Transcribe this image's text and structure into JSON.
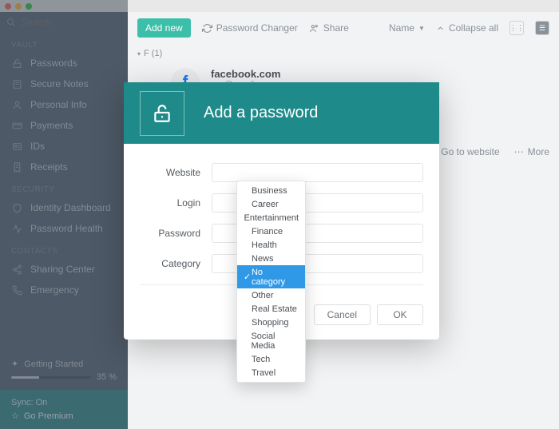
{
  "search": {
    "placeholder": "Search"
  },
  "sidebar": {
    "sections": {
      "vault": "Vault",
      "security": "Security",
      "contacts": "Contacts"
    },
    "items": [
      {
        "label": "Passwords",
        "icon": "lock-icon"
      },
      {
        "label": "Secure Notes",
        "icon": "note-icon"
      },
      {
        "label": "Personal Info",
        "icon": "person-icon"
      },
      {
        "label": "Payments",
        "icon": "card-icon"
      },
      {
        "label": "IDs",
        "icon": "id-icon"
      },
      {
        "label": "Receipts",
        "icon": "receipt-icon"
      }
    ],
    "security_items": [
      {
        "label": "Identity Dashboard",
        "icon": "shield-icon"
      },
      {
        "label": "Password Health",
        "icon": "pulse-icon"
      }
    ],
    "contacts_items": [
      {
        "label": "Sharing Center",
        "icon": "share-icon"
      },
      {
        "label": "Emergency",
        "icon": "phone-icon"
      }
    ],
    "getting_started": {
      "label": "Getting Started",
      "percent": "35 %"
    },
    "sync": {
      "status": "Sync: On",
      "premium": "Go Premium"
    }
  },
  "toolbar": {
    "add_new": "Add new",
    "password_changer": "Password Changer",
    "share": "Share",
    "name": "Name",
    "collapse_all": "Collapse all"
  },
  "list": {
    "section_label": "F (1)",
    "entry": {
      "title": "facebook.com",
      "subtitle": "xyz@gmail.com"
    }
  },
  "detail_actions": {
    "go_to_website": "Go to website",
    "more": "More"
  },
  "modal": {
    "title": "Add a password",
    "fields": {
      "website": "Website",
      "login": "Login",
      "password": "Password",
      "category": "Category"
    },
    "buttons": {
      "cancel": "Cancel",
      "ok": "OK"
    }
  },
  "dropdown": {
    "options": [
      "Business",
      "Career",
      "Entertainment",
      "Finance",
      "Health",
      "News",
      "No category",
      "Other",
      "Real Estate",
      "Shopping",
      "Social Media",
      "Tech",
      "Travel"
    ],
    "selected": "No category"
  }
}
